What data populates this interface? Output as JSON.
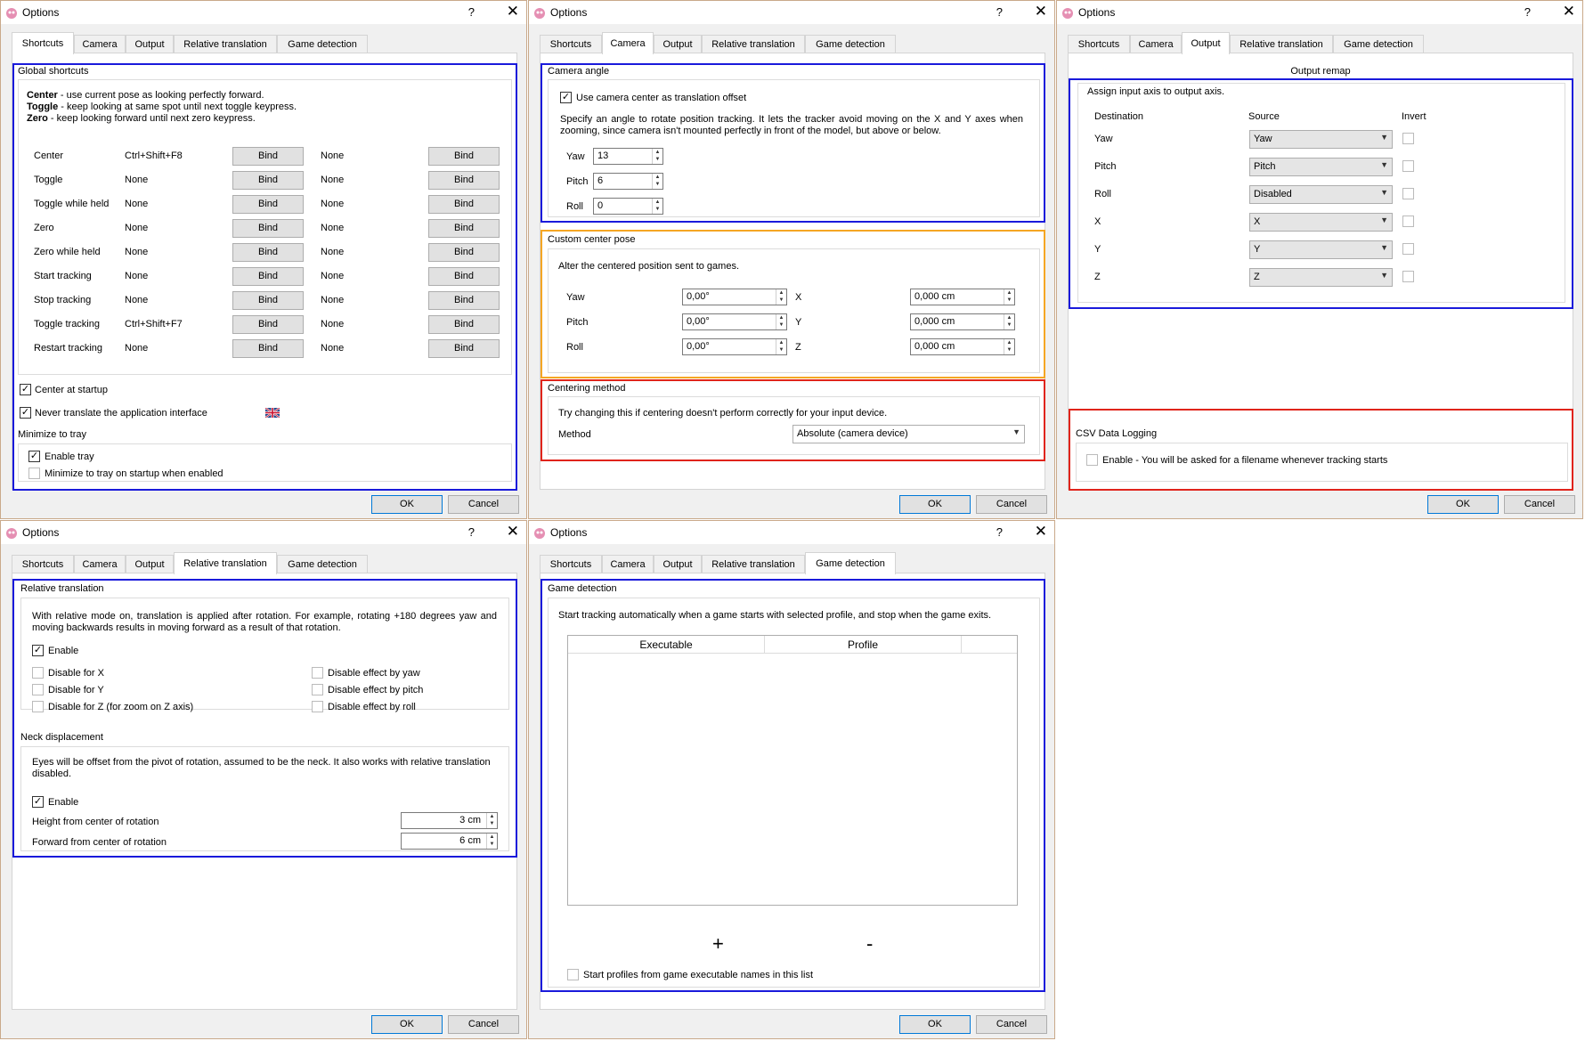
{
  "window": {
    "title": "Options",
    "help": "?",
    "close": "✕"
  },
  "tabs": [
    "Shortcuts",
    "Camera",
    "Output",
    "Relative translation",
    "Game detection"
  ],
  "buttons": {
    "ok": "OK",
    "cancel": "Cancel",
    "bind": "Bind"
  },
  "shortcuts": {
    "group_title": "Global shortcuts",
    "legend": [
      {
        "bold": "Center",
        "text": " - use current pose as looking perfectly forward."
      },
      {
        "bold": "Toggle",
        "text": " - keep looking at same spot until next toggle keypress."
      },
      {
        "bold": "Zero",
        "text": " - keep looking forward until next zero keypress."
      }
    ],
    "rows": [
      {
        "label": "Center",
        "key1": "Ctrl+Shift+F8",
        "key2": "None"
      },
      {
        "label": "Toggle",
        "key1": "None",
        "key2": "None"
      },
      {
        "label": "Toggle while held",
        "key1": "None",
        "key2": "None"
      },
      {
        "label": "Zero",
        "key1": "None",
        "key2": "None"
      },
      {
        "label": "Zero while held",
        "key1": "None",
        "key2": "None"
      },
      {
        "label": "Start tracking",
        "key1": "None",
        "key2": "None"
      },
      {
        "label": "Stop tracking",
        "key1": "None",
        "key2": "None"
      },
      {
        "label": "Toggle tracking",
        "key1": "Ctrl+Shift+F7",
        "key2": "None"
      },
      {
        "label": "Restart tracking",
        "key1": "None",
        "key2": "None"
      }
    ],
    "center_at_startup": {
      "label": "Center at startup",
      "checked": true
    },
    "never_translate": {
      "label": "Never translate the application interface",
      "checked": true
    },
    "tray_title": "Minimize to tray",
    "enable_tray": {
      "label": "Enable tray",
      "checked": true
    },
    "minimize_on_startup": {
      "label": "Minimize to tray on startup when enabled",
      "checked": false
    }
  },
  "camera": {
    "angle_title": "Camera angle",
    "use_center": {
      "label": "Use camera center as translation offset",
      "checked": true
    },
    "angle_desc": "Specify an angle to rotate position tracking. It lets the tracker avoid moving on the X and Y axes when zooming, since camera isn't mounted perfectly in front of the model, but above or below.",
    "angles": [
      {
        "label": "Yaw",
        "value": "13"
      },
      {
        "label": "Pitch",
        "value": "6"
      },
      {
        "label": "Roll",
        "value": "0"
      }
    ],
    "pose_title": "Custom center pose",
    "pose_desc": "Alter the centered position sent to games.",
    "pose_rows": [
      {
        "label": "Yaw",
        "rot": "0,00°",
        "axis": "X",
        "pos": "0,000 cm"
      },
      {
        "label": "Pitch",
        "rot": "0,00°",
        "axis": "Y",
        "pos": "0,000 cm"
      },
      {
        "label": "Roll",
        "rot": "0,00°",
        "axis": "Z",
        "pos": "0,000 cm"
      }
    ],
    "method_title": "Centering method",
    "method_desc": "Try changing this if centering doesn't perform correctly for your input device.",
    "method_label": "Method",
    "method_value": "Absolute (camera device)"
  },
  "output": {
    "remap_title": "Output remap",
    "remap_desc": "Assign input axis to output axis.",
    "headers": {
      "destination": "Destination",
      "source": "Source",
      "invert": "Invert"
    },
    "rows": [
      {
        "dest": "Yaw",
        "source": "Yaw",
        "invert": false
      },
      {
        "dest": "Pitch",
        "source": "Pitch",
        "invert": false
      },
      {
        "dest": "Roll",
        "source": "Disabled",
        "invert": false
      },
      {
        "dest": "X",
        "source": "X",
        "invert": false
      },
      {
        "dest": "Y",
        "source": "Y",
        "invert": false
      },
      {
        "dest": "Z",
        "source": "Z",
        "invert": false
      }
    ],
    "csv_title": "CSV Data Logging",
    "csv_enable": {
      "label": "Enable - You will be asked for a filename whenever tracking starts",
      "checked": false
    }
  },
  "reltrans": {
    "title": "Relative translation",
    "desc": "With relative mode on, translation is applied after rotation. For example, rotating +180 degrees yaw and moving backwards results in moving forward as a result of that rotation.",
    "enable": {
      "label": "Enable",
      "checked": true
    },
    "left_opts": [
      "Disable for X",
      "Disable for Y",
      "Disable for Z (for zoom on Z axis)"
    ],
    "right_opts": [
      "Disable effect by yaw",
      "Disable effect by pitch",
      "Disable effect by roll"
    ],
    "neck_title": "Neck displacement",
    "neck_desc": "Eyes will be offset from the pivot of rotation, assumed to be the neck. It also works with relative translation disabled.",
    "neck_enable": {
      "label": "Enable",
      "checked": true
    },
    "height_label": "Height from center of rotation",
    "height_value": "3 cm",
    "forward_label": "Forward from center of rotation",
    "forward_value": "6 cm"
  },
  "gamedet": {
    "title": "Game detection",
    "desc": "Start tracking automatically when a game starts with selected profile, and stop when the game exits.",
    "col_exec": "Executable",
    "col_profile": "Profile",
    "add": "+",
    "remove": "-",
    "start_profiles": {
      "label": "Start profiles from game executable names in this list",
      "checked": false
    }
  }
}
